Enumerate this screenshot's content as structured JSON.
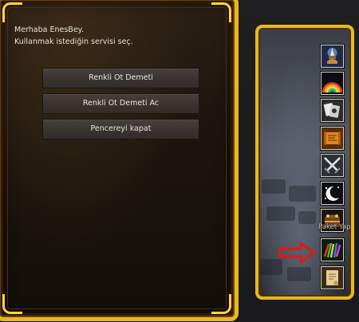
{
  "dialog": {
    "greeting_line1": "Merhaba EnesBey.",
    "greeting_line2": "Kullanmak istediğin servisi seç.",
    "options": [
      {
        "label": "Renkli Ot Demeti"
      },
      {
        "label": "Renkli Ot Demeti Ac"
      },
      {
        "label": "Pencereyi kapat"
      }
    ]
  },
  "quickbar": {
    "slots": [
      {
        "icon": "lamp-icon"
      },
      {
        "icon": "rainbow-icon"
      },
      {
        "icon": "cards-icon"
      },
      {
        "icon": "scroll-map-icon"
      },
      {
        "icon": "crossed-swords-icon"
      },
      {
        "icon": "moon-stars-icon"
      },
      {
        "icon": "treasure-chest-icon"
      },
      {
        "icon": "colorful-herbs-icon"
      },
      {
        "icon": "parchment-icon"
      }
    ],
    "tooltip": "Paket Yap"
  },
  "colors": {
    "frame_gold": "#e9b81d",
    "arrow_red": "#e01818",
    "button_text": "#ece7df"
  }
}
